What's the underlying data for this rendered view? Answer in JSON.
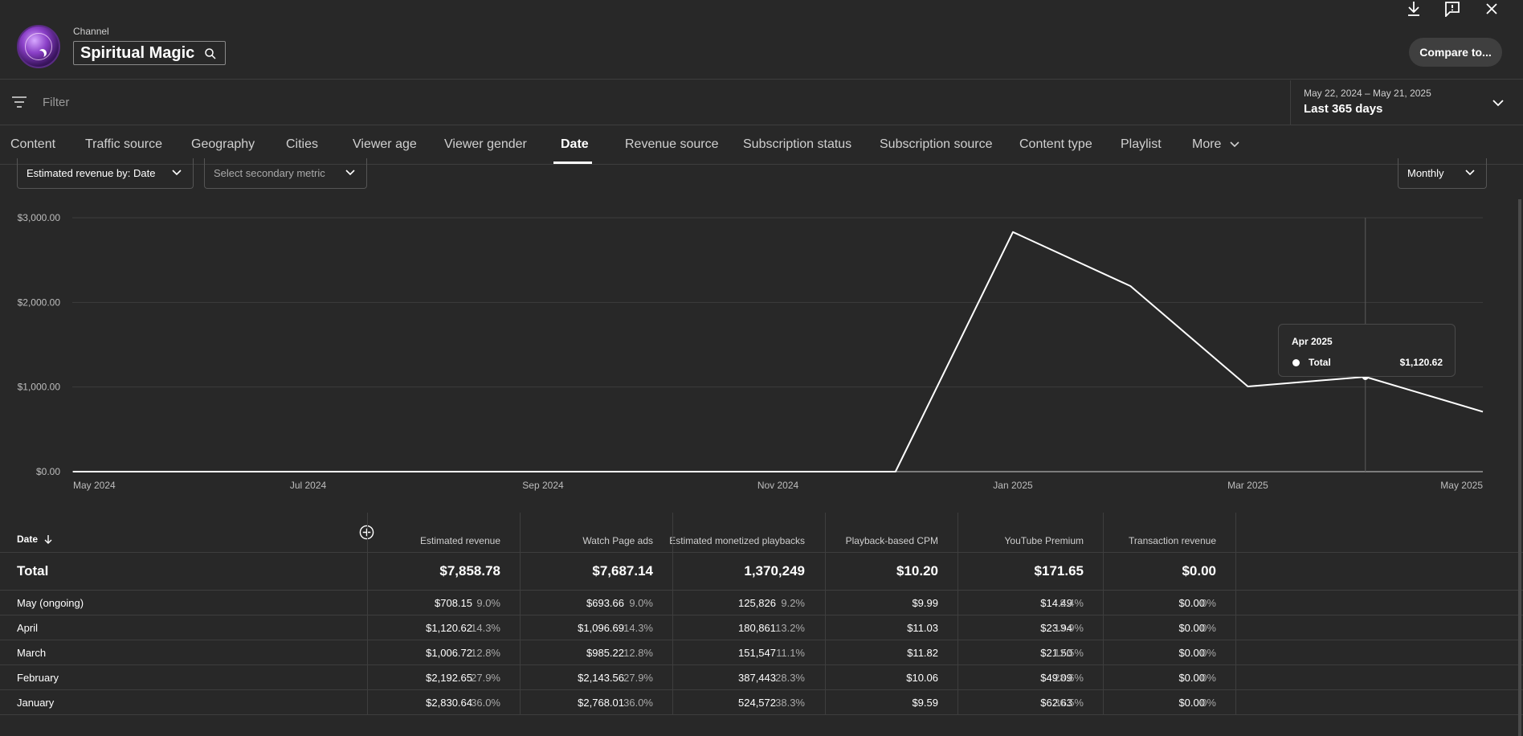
{
  "header": {
    "channel_label": "Channel",
    "channel_name": "Spiritual Magic",
    "compare_label": "Compare to..."
  },
  "filter": {
    "placeholder": "Filter",
    "date_range": "May 22, 2024 – May 21, 2025",
    "date_preset": "Last 365 days"
  },
  "tabs": [
    "Content",
    "Traffic source",
    "Geography",
    "Cities",
    "Viewer age",
    "Viewer gender",
    "Date",
    "Revenue source",
    "Subscription status",
    "Subscription source",
    "Content type",
    "Playlist",
    "More"
  ],
  "active_tab": "Date",
  "controls": {
    "primary_metric": "Estimated revenue by: Date",
    "secondary_metric": "Select secondary metric",
    "interval": "Monthly"
  },
  "chart_data": {
    "type": "line",
    "x": [
      "2024-05",
      "2024-06",
      "2024-07",
      "2024-08",
      "2024-09",
      "2024-10",
      "2024-11",
      "2024-12",
      "2025-01",
      "2025-02",
      "2025-03",
      "2025-04",
      "2025-05"
    ],
    "x_tick_labels": [
      "May 2024",
      "Jul 2024",
      "Sep 2024",
      "Nov 2024",
      "Jan 2025",
      "Mar 2025",
      "May 2025"
    ],
    "series": [
      {
        "values": [
          0,
          0,
          0,
          0,
          0,
          0,
          0,
          0,
          2830.64,
          2192.65,
          1006.72,
          1120.62,
          708.15
        ]
      }
    ],
    "y_tick_labels": [
      "$0.00",
      "$1,000.00",
      "$2,000.00",
      "$3,000.00"
    ],
    "ylim": [
      0,
      3000
    ],
    "grid": true,
    "tooltip": {
      "month": "Apr 2025",
      "label": "Total",
      "value": "$1,120.62"
    }
  },
  "table": {
    "date_header": "Date",
    "columns": [
      {
        "label": "Estimated revenue"
      },
      {
        "label": "Watch Page ads"
      },
      {
        "label": "Estimated monetized playbacks"
      },
      {
        "label": "Playback-based CPM"
      },
      {
        "label": "YouTube Premium"
      },
      {
        "label": "Transaction revenue"
      }
    ],
    "total": {
      "label": "Total",
      "values": [
        "$7,858.78",
        "$7,687.14",
        "1,370,249",
        "$10.20",
        "$171.65",
        "$0.00"
      ]
    },
    "rows": [
      {
        "date": "May (ongoing)",
        "cells": [
          [
            "$708.15",
            "9.0%"
          ],
          [
            "$693.66",
            "9.0%"
          ],
          [
            "125,826",
            "9.2%"
          ],
          [
            "$9.99",
            ""
          ],
          [
            "$14.49",
            "8.4%"
          ],
          [
            "$0.00",
            "0%"
          ]
        ]
      },
      {
        "date": "April",
        "cells": [
          [
            "$1,120.62",
            "14.3%"
          ],
          [
            "$1,096.69",
            "14.3%"
          ],
          [
            "180,861",
            "13.2%"
          ],
          [
            "$11.03",
            ""
          ],
          [
            "$23.94",
            "13.9%"
          ],
          [
            "$0.00",
            "0%"
          ]
        ]
      },
      {
        "date": "March",
        "cells": [
          [
            "$1,006.72",
            "12.8%"
          ],
          [
            "$985.22",
            "12.8%"
          ],
          [
            "151,547",
            "11.1%"
          ],
          [
            "$11.82",
            ""
          ],
          [
            "$21.50",
            "12.5%"
          ],
          [
            "$0.00",
            "0%"
          ]
        ]
      },
      {
        "date": "February",
        "cells": [
          [
            "$2,192.65",
            "27.9%"
          ],
          [
            "$2,143.56",
            "27.9%"
          ],
          [
            "387,443",
            "28.3%"
          ],
          [
            "$10.06",
            ""
          ],
          [
            "$49.09",
            "28.6%"
          ],
          [
            "$0.00",
            "0%"
          ]
        ]
      },
      {
        "date": "January",
        "cells": [
          [
            "$2,830.64",
            "36.0%"
          ],
          [
            "$2,768.01",
            "36.0%"
          ],
          [
            "524,572",
            "38.3%"
          ],
          [
            "$9.59",
            ""
          ],
          [
            "$62.63",
            "36.5%"
          ],
          [
            "$0.00",
            "0%"
          ]
        ]
      }
    ]
  }
}
